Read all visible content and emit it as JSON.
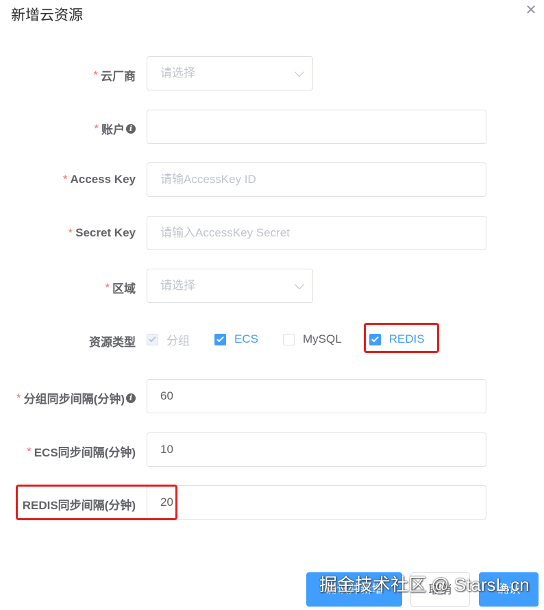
{
  "dialog": {
    "title": "新增云资源",
    "close_icon": "close-icon"
  },
  "form": {
    "provider": {
      "label": "云厂商",
      "placeholder": "请选择"
    },
    "account": {
      "label": "账户",
      "value": ""
    },
    "access_key": {
      "label": "Access Key",
      "placeholder": "请输AccessKey ID"
    },
    "secret_key": {
      "label": "Secret Key",
      "placeholder": "请输入AccessKey Secret"
    },
    "region": {
      "label": "区域",
      "placeholder": "请选择"
    },
    "resource_type": {
      "label": "资源类型",
      "options": [
        {
          "label": "分组",
          "checked": true,
          "disabled": true
        },
        {
          "label": "ECS",
          "checked": true,
          "disabled": false
        },
        {
          "label": "MySQL",
          "checked": false,
          "disabled": false
        },
        {
          "label": "REDIS",
          "checked": true,
          "disabled": false
        }
      ]
    },
    "group_interval": {
      "label": "分组同步间隔(分钟)",
      "value": "60"
    },
    "ecs_interval": {
      "label": "ECS同步间隔(分钟)",
      "value": "10"
    },
    "redis_interval": {
      "label": "REDIS同步间隔(分钟)",
      "value": "20"
    }
  },
  "footer": {
    "save_and_new": "确认并新增",
    "cancel": "取消",
    "confirm": "确认"
  },
  "watermark": "掘金技术社区 @ StarsL.cn",
  "colors": {
    "primary": "#409eff",
    "required": "#f56c6c",
    "highlight": "#e0201b"
  }
}
